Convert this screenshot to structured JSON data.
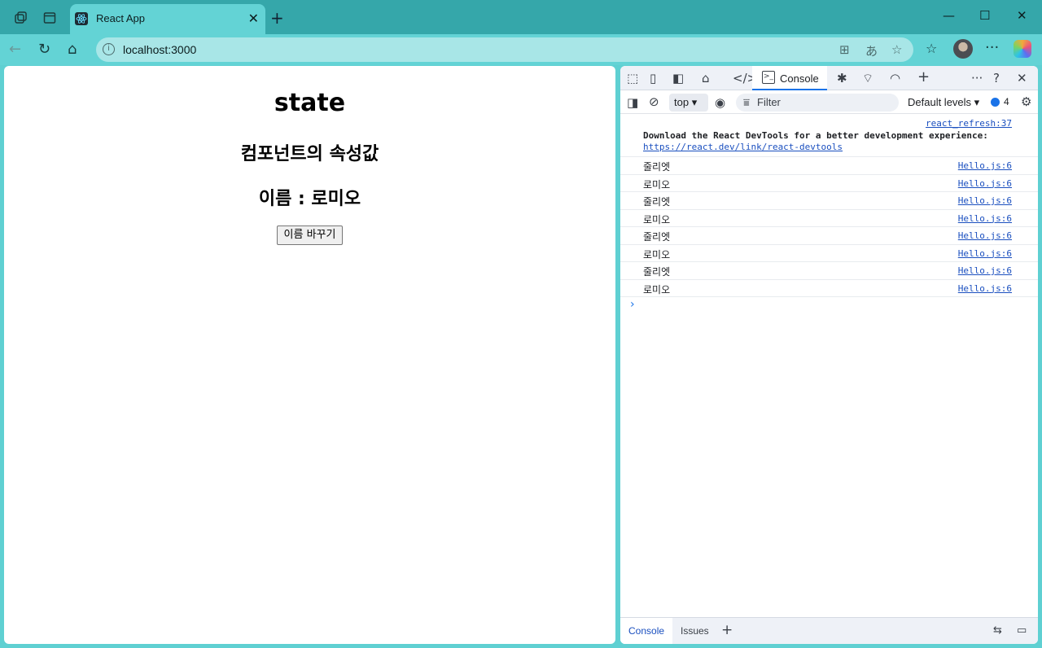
{
  "browser": {
    "tab_title": "React App",
    "tab_close": "✕",
    "new_tab": "+",
    "url": "localhost:3000",
    "window_controls": [
      "—",
      "☐",
      "✕"
    ]
  },
  "page": {
    "heading": "state",
    "subheading": "컴포넌트의 속성값",
    "name_line": "이름 : 로미오",
    "button_label": "이름 바꾸기"
  },
  "devtools": {
    "active_tab": "Console",
    "context": "top",
    "filter_placeholder": "Filter",
    "levels": "Default levels",
    "issues_count": "4",
    "info_message": {
      "source": "react_refresh:37",
      "text": "Download the React DevTools for a better development experience:",
      "link": "https://react.dev/link/react-devtools"
    },
    "logs": [
      {
        "text": "줄리엣",
        "source": "Hello.js:6"
      },
      {
        "text": "로미오",
        "source": "Hello.js:6"
      },
      {
        "text": "줄리엣",
        "source": "Hello.js:6"
      },
      {
        "text": "로미오",
        "source": "Hello.js:6"
      },
      {
        "text": "줄리엣",
        "source": "Hello.js:6"
      },
      {
        "text": "로미오",
        "source": "Hello.js:6"
      },
      {
        "text": "줄리엣",
        "source": "Hello.js:6"
      },
      {
        "text": "로미오",
        "source": "Hello.js:6"
      }
    ],
    "prompt": "›",
    "drawer_tabs": [
      "Console",
      "Issues"
    ]
  },
  "colors": {
    "titlebar": "#35a7aa",
    "toolbar": "#63d3d5",
    "frame": "#5fd0d2",
    "link": "#1a4fbf",
    "accent": "#1a73e8"
  }
}
